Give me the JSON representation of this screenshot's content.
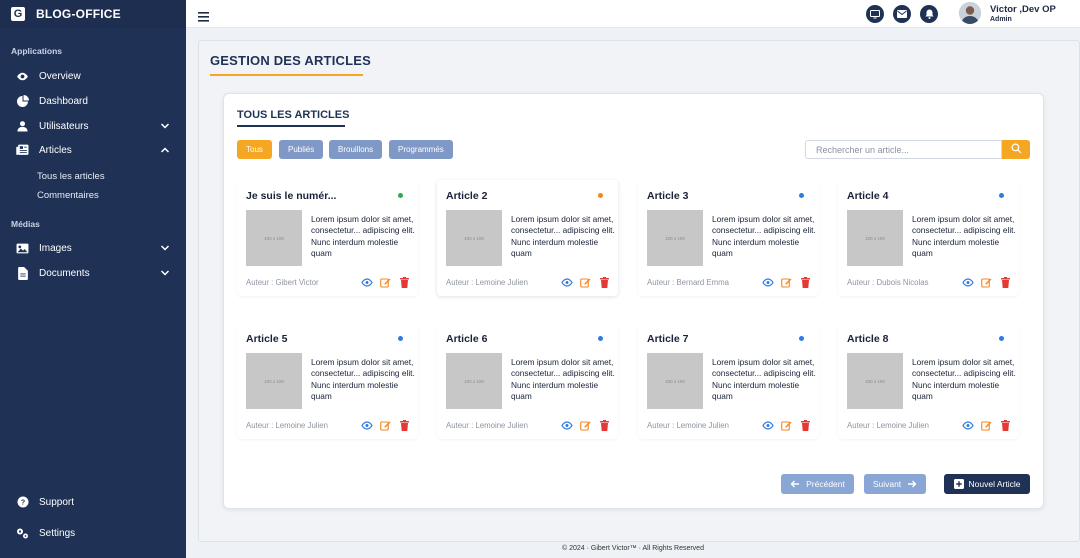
{
  "brand": {
    "logo_letter": "G",
    "name": "BLOG-OFFICE"
  },
  "sidebar": {
    "section_apps": "Applications",
    "items": [
      {
        "label": "Overview",
        "icon": "eye-icon"
      },
      {
        "label": "Dashboard",
        "icon": "pie-chart-icon"
      },
      {
        "label": "Utilisateurs",
        "icon": "user-icon"
      },
      {
        "label": "Articles",
        "icon": "newspaper-icon"
      }
    ],
    "sub_items": [
      "Tous les articles",
      "Commentaires"
    ],
    "section_media": "Médias",
    "media_items": [
      {
        "label": "Images",
        "icon": "image-icon"
      },
      {
        "label": "Documents",
        "icon": "document-icon"
      }
    ],
    "support": "Support",
    "settings": "Settings"
  },
  "topbar": {
    "user_name": "Victor ,Dev OP",
    "user_role": "Admin",
    "icons": [
      "monitor-icon",
      "mail-icon",
      "bell-icon"
    ]
  },
  "page": {
    "title": "GESTION DES ARTICLES",
    "card_title": "TOUS LES ARTICLES",
    "filters": [
      "Tous",
      "Publiés",
      "Brouillons",
      "Programmés"
    ],
    "active_filter": "Tous",
    "search_placeholder": "Rechercher un article..."
  },
  "articles": [
    {
      "title": "Je suis le numér...",
      "excerpt": "Lorem ipsum dolor sit amet, consectetur... adipiscing elit. Nunc interdum molestie quam",
      "author": "Auteur : Gibert Victor",
      "status_color": "#2eaa4f",
      "thumb": "100 x 100"
    },
    {
      "title": "Article 2",
      "excerpt": "Lorem ipsum dolor sit amet, consectetur... adipiscing elit. Nunc interdum molestie quam",
      "author": "Auteur : Lemoine Julien",
      "status_color": "#f5841f",
      "thumb": "100 x 100"
    },
    {
      "title": "Article 3",
      "excerpt": "Lorem ipsum dolor sit amet, consectetur... adipiscing elit. Nunc interdum molestie quam",
      "author": "Auteur : Bernard Emma",
      "status_color": "#2f7be0",
      "thumb": "100 x 100"
    },
    {
      "title": "Article 4",
      "excerpt": "Lorem ipsum dolor sit amet, consectetur... adipiscing elit. Nunc interdum molestie quam",
      "author": "Auteur : Dubois Nicolas",
      "status_color": "#2f7be0",
      "thumb": "100 x 100"
    },
    {
      "title": "Article 5",
      "excerpt": "Lorem ipsum dolor sit amet, consectetur... adipiscing elit. Nunc interdum molestie quam",
      "author": "Auteur : Lemoine Julien",
      "status_color": "#2f7be0",
      "thumb": "100 x 100"
    },
    {
      "title": "Article 6",
      "excerpt": "Lorem ipsum dolor sit amet, consectetur... adipiscing elit. Nunc interdum molestie quam",
      "author": "Auteur : Lemoine Julien",
      "status_color": "#2f7be0",
      "thumb": "100 x 100"
    },
    {
      "title": "Article 7",
      "excerpt": "Lorem ipsum dolor sit amet, consectetur... adipiscing elit. Nunc interdum molestie quam",
      "author": "Auteur : Lemoine Julien",
      "status_color": "#2f7be0",
      "thumb": "100 x 100"
    },
    {
      "title": "Article 8",
      "excerpt": "Lorem ipsum dolor sit amet, consectetur... adipiscing elit. Nunc interdum molestie quam",
      "author": "Auteur : Lemoine Julien",
      "status_color": "#2f7be0",
      "thumb": "100 x 100"
    }
  ],
  "pagination": {
    "prev": "Précédent",
    "next": "Suivant",
    "new_article": "Nouvel Article"
  },
  "footer": "© 2024 · Gibert Victor™ · All Rights Reserved",
  "colors": {
    "sidebar": "#1f3256",
    "accent": "#f5a623",
    "filter": "#7f98c6",
    "view": "#2f7be0",
    "edit": "#f5841f",
    "delete": "#e53935"
  }
}
